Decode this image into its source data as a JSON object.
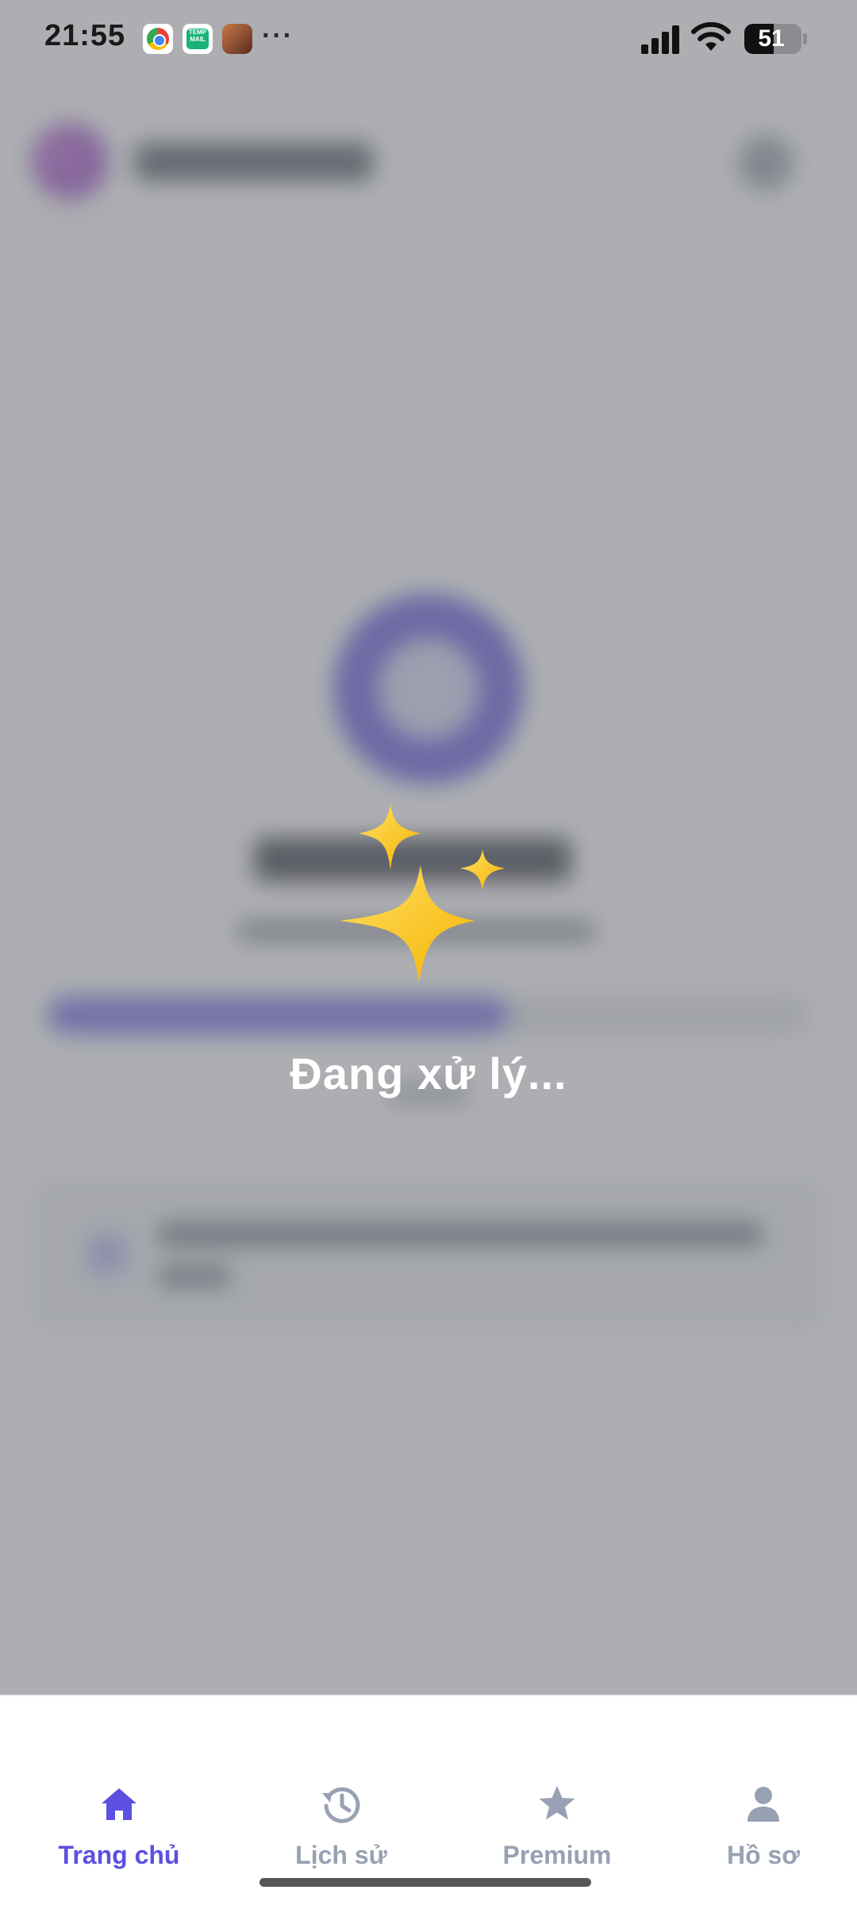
{
  "status_bar": {
    "time": "21:55",
    "notification_icons": [
      "chrome-icon",
      "temp-mail-icon",
      "game-icon"
    ],
    "temp_mail_label": "TEMP MAIL",
    "more": "···",
    "battery_level": "51"
  },
  "overlay": {
    "icon": "sparkles-icon",
    "message": "Đang xử lý..."
  },
  "tab_bar": {
    "active_color": "#5b50e0",
    "inactive_color": "#98a1b3",
    "tabs": [
      {
        "label": "Trang chủ",
        "icon": "home-icon",
        "active": true
      },
      {
        "label": "Lịch sử",
        "icon": "history-icon",
        "active": false
      },
      {
        "label": "Premium",
        "icon": "star-icon",
        "active": false
      },
      {
        "label": "Hồ sơ",
        "icon": "person-icon",
        "active": false
      }
    ]
  }
}
